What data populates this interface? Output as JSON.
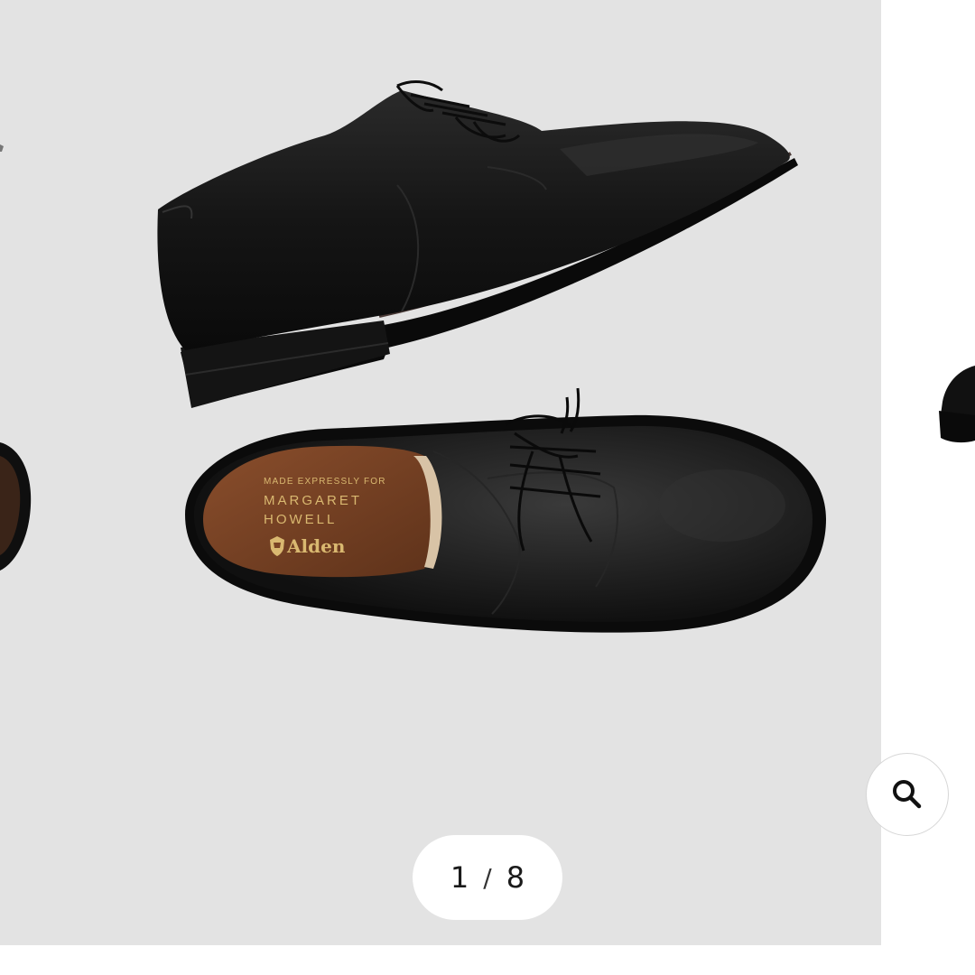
{
  "gallery": {
    "current_index": "1",
    "separator": "/",
    "total": "8"
  },
  "insole": {
    "line1": "MADE EXPRESSLY FOR",
    "line2": "MARGARET",
    "line3": "HOWELL",
    "brand": "Alden"
  },
  "colors": {
    "slide_background": "#e3e3e3",
    "page_background": "#ffffff",
    "leather": "#121212",
    "insole": "#7a4324",
    "gold": "#d9b870"
  },
  "icons": {
    "zoom": "search-icon"
  }
}
